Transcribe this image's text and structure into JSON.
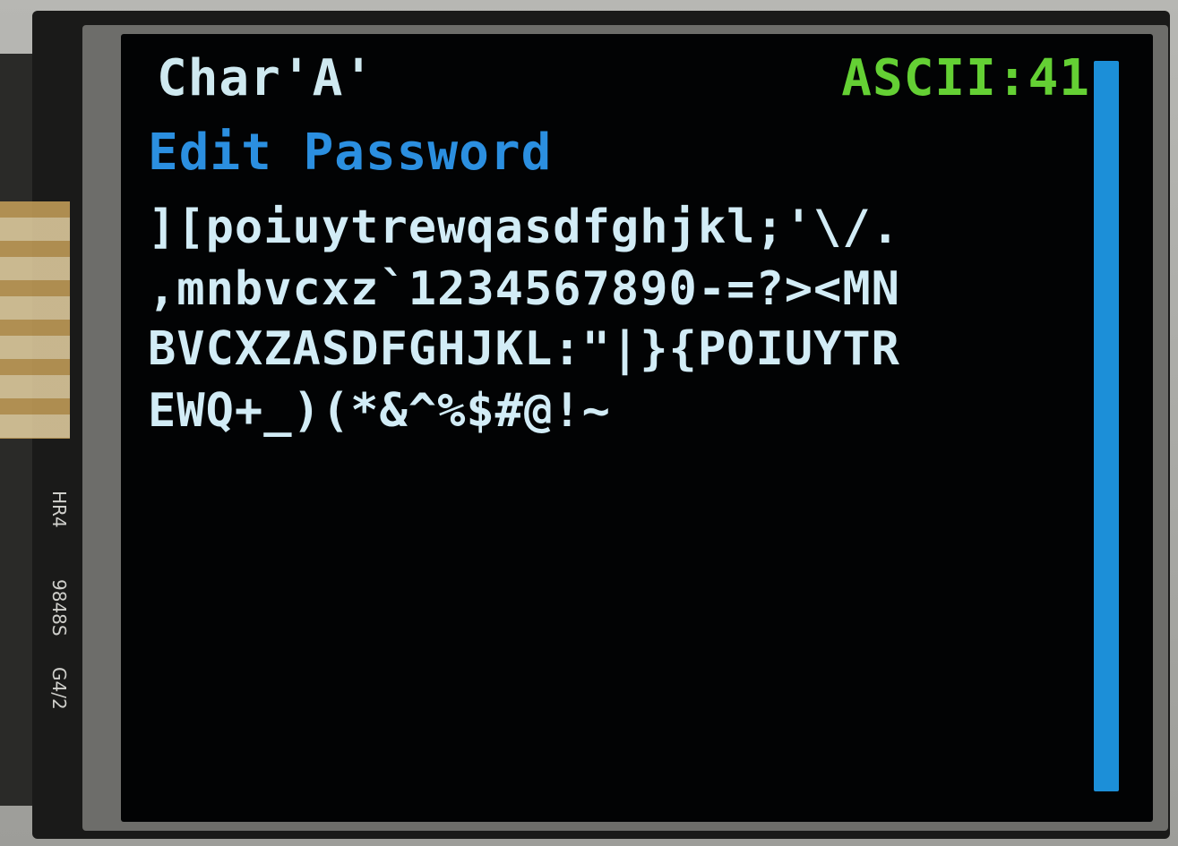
{
  "screen": {
    "char_display": "Char'A'",
    "ascii_display": "ASCII:41",
    "title": "Edit Password",
    "password_lines": [
      "][poiuytrewqasdfghjkl;'\\/.",
      ",mnbvcxz`1234567890-=?><MN",
      "BVCXZASDFGHJKL:\"|}{POIUYTR",
      "EWQ+_)(*&^%$#@!~"
    ]
  },
  "device": {
    "side_print": [
      "HR4",
      "9848S",
      "G4/2"
    ]
  },
  "colors": {
    "char_text": "#cfe9f0",
    "ascii_text": "#64d034",
    "title_text": "#2b8fe0",
    "password_text": "#d2ecf6",
    "scrollbar": "#1c8fd8",
    "screen_bg": "#020304"
  }
}
